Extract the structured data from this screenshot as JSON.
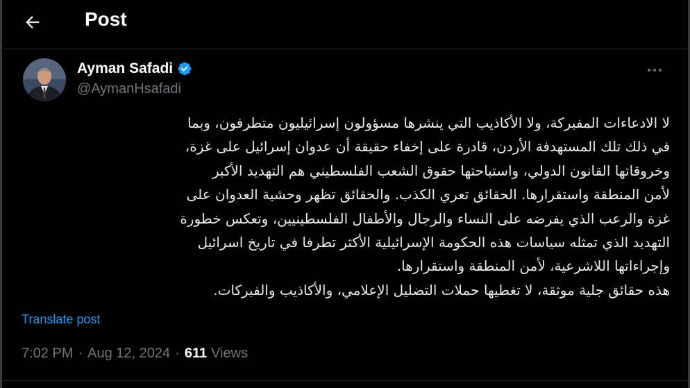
{
  "header": {
    "title": "Post",
    "back_icon": "arrow-left-icon"
  },
  "author": {
    "name": "Ayman Safadi",
    "handle": "@AymanHsafadi",
    "verified_icon": "verified-badge-icon",
    "verified_color": "#1d9bf0"
  },
  "post": {
    "lines": [
      "لا الادعاءات المفبركة، ولا الأكاذيب التي ينشرها مسؤولون إسرائيليون متطرفون، وبما",
      "في ذلك تلك المستهدفة الأردن، قادرة على إخفاء حقيقة أن عدوان إسرائيل على غزة،",
      "وخروقاتها القانون الدولي، واستباحتها حقوق الشعب الفلسطيني هم التهديد  الأكبر",
      "لأمن المنطقة واستقرارها. الحقائق تعري الكذب. والحقائق تظهر وحشية العدوان على",
      "غزة والرعب الذي يفرضه على النساء والرجال والأطفال الفلسطينيين، وتعكس خطورة",
      "التهديد الذي تمثله سياسات هذه الحكومة الإسرائيلية الأكثر  تطرفا في تاريخ اسرائيل",
      "وإجراءاتها اللاشرعية، لأمن المنطقة واستقرارها.",
      "هذه حقائق جلية موثقة، لا تغطيها حملات التضليل الإعلامي، والأكاذيب والفبركات."
    ],
    "translate_label": "Translate post",
    "time": "7:02 PM",
    "separator": "·",
    "date": "Aug 12, 2024",
    "views_count": "611",
    "views_label": "Views"
  },
  "colors": {
    "background": "#000000",
    "text_primary": "#e7e9ea",
    "text_secondary": "#71767b",
    "link": "#1d9bf0"
  }
}
